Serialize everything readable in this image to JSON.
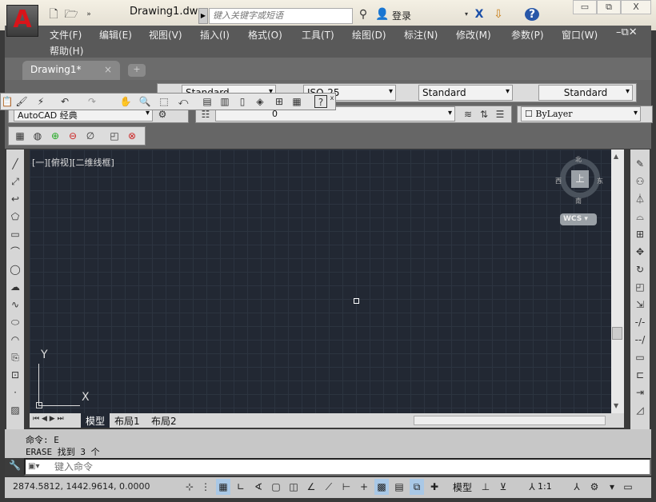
{
  "title_bar": {
    "document_title": "Drawing1.dwg",
    "search_placeholder": "键入关键字或短语",
    "login_label": "登录",
    "help_label": "?",
    "exchange_label": "X"
  },
  "window_controls": {
    "minimize": "▭",
    "restore": "⧉",
    "close": "X"
  },
  "menu": {
    "items": [
      "文件(F)",
      "编辑(E)",
      "视图(V)",
      "插入(I)",
      "格式(O)",
      "工具(T)",
      "绘图(D)",
      "标注(N)",
      "修改(M)",
      "参数(P)",
      "窗口(W)",
      "帮助(H)"
    ]
  },
  "doc_tab": {
    "label": "Drawing1*",
    "close": "×"
  },
  "styles_toolbar": {
    "text_style": "Standard",
    "dim_style": "ISO-25",
    "table_style": "Standard",
    "multileader_style": "Standard"
  },
  "workspace": {
    "value": "AutoCAD 经典"
  },
  "layer": {
    "value": "0"
  },
  "color": {
    "value": "ByLayer"
  },
  "viewport": {
    "label": "[一][俯视][二维线框]"
  },
  "viewcube": {
    "north": "北",
    "south": "南",
    "east": "东",
    "west": "西",
    "top": "上",
    "ucs": "WCS"
  },
  "ucs_icon": {
    "x": "X",
    "y": "Y"
  },
  "layout_tabs": [
    "模型",
    "布局1",
    "布局2"
  ],
  "command": {
    "history": [
      "命令: E",
      "ERASE 找到 3 个"
    ],
    "placeholder": "键入命令",
    "close": "X"
  },
  "status": {
    "coordinates": "2874.5812, 1442.9614, 0.0000",
    "model_label": "模型",
    "scale": "1:1"
  }
}
